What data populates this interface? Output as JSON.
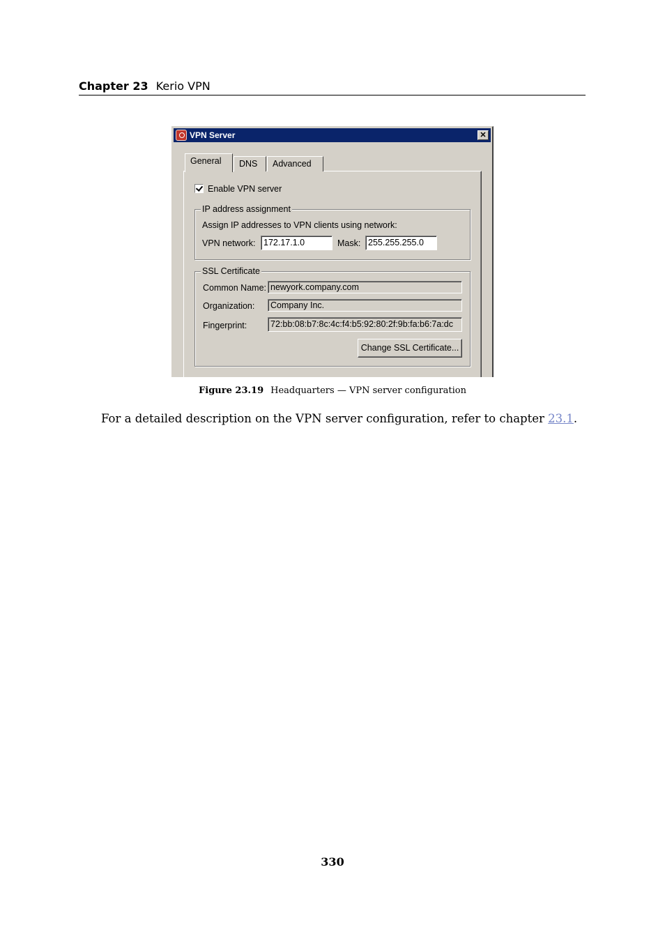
{
  "header": {
    "chapter_label": "Chapter 23",
    "chapter_title": "Kerio VPN"
  },
  "dialog": {
    "title": "VPN Server",
    "close_glyph": "✕",
    "tabs": [
      {
        "label": "General",
        "active": true
      },
      {
        "label": "DNS",
        "active": false
      },
      {
        "label": "Advanced",
        "active": false
      }
    ],
    "enable_vpn": {
      "label": "Enable VPN server",
      "checked": true
    },
    "ip_assignment": {
      "legend": "IP address assignment",
      "description": "Assign IP addresses to VPN clients using network:",
      "network_label": "VPN network:",
      "network_value": "172.17.1.0",
      "mask_label": "Mask:",
      "mask_value": "255.255.255.0"
    },
    "ssl": {
      "legend": "SSL Certificate",
      "common_name_label": "Common Name:",
      "common_name_value": "newyork.company.com",
      "organization_label": "Organization:",
      "organization_value": "Company Inc.",
      "fingerprint_label": "Fingerprint:",
      "fingerprint_value": "72:bb:08:b7:8c:4c:f4:b5:92:80:2f:9b:fa:b6:7a:dc",
      "change_button": "Change SSL Certificate..."
    }
  },
  "caption": {
    "number": "Figure 23.19",
    "text": "Headquarters — VPN server configuration"
  },
  "body": {
    "text_before": "For a detailed description on the VPN server configuration, refer to chapter ",
    "link_text": "23.1",
    "text_after": "."
  },
  "page_number": "330"
}
